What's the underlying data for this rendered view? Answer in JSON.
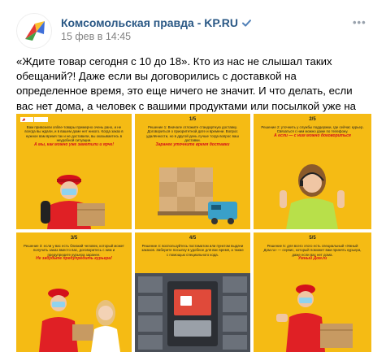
{
  "post": {
    "author": "Комсомольская правда - KP.RU",
    "date": "15 фев в 14:45",
    "more_glyph": "•••",
    "text": "«Ждите товар сегодня с 10 до 18». Кто из нас не слышал таких обещаний?! Даже если вы договорились с доставкой на определенное время, это еще ничего не значит. И что делать, если вас нет дома, а человек с вашими продуктами или посылкой уже на подходе?"
  },
  "colors": {
    "link": "#2a5885",
    "tile_bg": "#f5bb14",
    "accent_red": "#d3101b",
    "verified": "#5181b8"
  },
  "tiles": [
    {
      "num": "",
      "caption": "Вам привозили online-товары примерно очень рано, и не всегда вы ждали, и в вашем доме нет никого. Когда заказ в нужное вам время так и не доставили, вы оказываетесь в неудобной ситуации.",
      "highlight": "А мы, как можно уже заметили и ярче!",
      "illustration": "courier-with-box"
    },
    {
      "num": "1/5",
      "caption": "Решение 1: Вначале отложите стандартную доставку. Договориться о приоритетной дате и времени. Вопрос удалённости, но в другой день лучше тогда вопрос ваш доставки.",
      "highlight": "Заранее уточните время доставки",
      "illustration": "boxes-on-pallet"
    },
    {
      "num": "2/5",
      "caption": "Решение 2: уточнить у службы поддержки, где сейчас курьер. Связаться с ним можно даже по телефону.",
      "highlight": "А если — с ним можно договориться",
      "illustration": "woman-with-headset"
    },
    {
      "num": "3/5",
      "caption": "Решение 3: если у вас есть близкий человек, который может получить заказ вместо вас, договоритесь с ним и предупредите курьера заранее.",
      "highlight": "Не забудьте предупредить курьера!",
      "illustration": "courier-handing-box"
    },
    {
      "num": "4/5",
      "caption": "Решение 4: воспользуйтесь постаматом или пунктом выдачи заказов. Заберите посылку в удобное для вас время, а также с помощью специального кода.",
      "highlight": "",
      "illustration": "parcel-locker"
    },
    {
      "num": "5/5",
      "caption": "Решение 5: для всего этого есть специальный «Умный Дом.ru» — сервис, который поможет вам принять курьера, даже если вас нет дома.",
      "highlight": "Умный Дом.ru",
      "illustration": "courier-at-door"
    }
  ]
}
